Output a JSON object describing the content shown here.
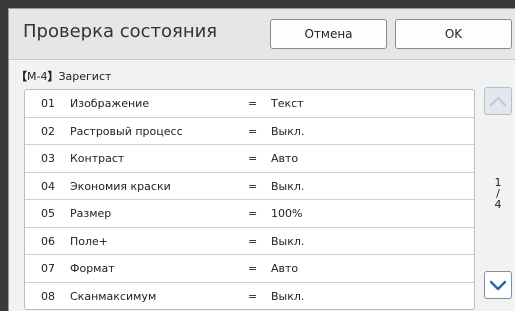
{
  "header": {
    "title": "Проверка состояния",
    "cancel_label": "Отмена",
    "ok_label": "OK"
  },
  "section": {
    "code": "М-4",
    "label": "Зарегист"
  },
  "rows": [
    {
      "num": "01",
      "name": "Изображение",
      "eq": "=",
      "value": "Текст"
    },
    {
      "num": "02",
      "name": "Растровый процесс",
      "eq": "=",
      "value": "Выкл."
    },
    {
      "num": "03",
      "name": "Контраст",
      "eq": "=",
      "value": "Авто"
    },
    {
      "num": "04",
      "name": "Экономия краски",
      "eq": "=",
      "value": "Выкл."
    },
    {
      "num": "05",
      "name": "Размер",
      "eq": "=",
      "value": "100%"
    },
    {
      "num": "06",
      "name": "Поле+",
      "eq": "=",
      "value": "Выкл."
    },
    {
      "num": "07",
      "name": "Формат",
      "eq": "=",
      "value": "Авто"
    },
    {
      "num": "08",
      "name": "Сканмаксимум",
      "eq": "=",
      "value": "Выкл."
    }
  ],
  "pager": {
    "current": "1",
    "separator": "/",
    "total": "4"
  },
  "colors": {
    "accent_arrow": "#2b6aa8",
    "disabled_arrow": "#c5ced8"
  },
  "icons": {
    "up": "chevron-up-icon",
    "down": "chevron-down-icon"
  }
}
